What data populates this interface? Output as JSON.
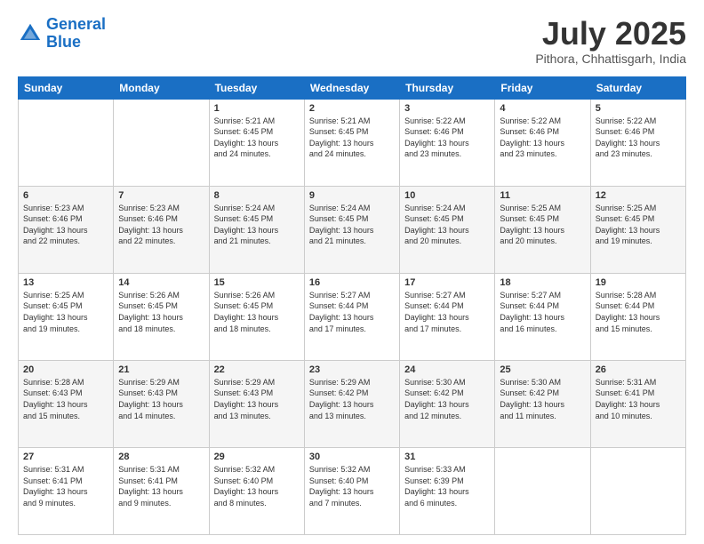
{
  "logo": {
    "line1": "General",
    "line2": "Blue"
  },
  "header": {
    "month": "July 2025",
    "location": "Pithora, Chhattisgarh, India"
  },
  "weekdays": [
    "Sunday",
    "Monday",
    "Tuesday",
    "Wednesday",
    "Thursday",
    "Friday",
    "Saturday"
  ],
  "weeks": [
    [
      {
        "day": "",
        "info": ""
      },
      {
        "day": "",
        "info": ""
      },
      {
        "day": "1",
        "info": "Sunrise: 5:21 AM\nSunset: 6:45 PM\nDaylight: 13 hours\nand 24 minutes."
      },
      {
        "day": "2",
        "info": "Sunrise: 5:21 AM\nSunset: 6:45 PM\nDaylight: 13 hours\nand 24 minutes."
      },
      {
        "day": "3",
        "info": "Sunrise: 5:22 AM\nSunset: 6:46 PM\nDaylight: 13 hours\nand 23 minutes."
      },
      {
        "day": "4",
        "info": "Sunrise: 5:22 AM\nSunset: 6:46 PM\nDaylight: 13 hours\nand 23 minutes."
      },
      {
        "day": "5",
        "info": "Sunrise: 5:22 AM\nSunset: 6:46 PM\nDaylight: 13 hours\nand 23 minutes."
      }
    ],
    [
      {
        "day": "6",
        "info": "Sunrise: 5:23 AM\nSunset: 6:46 PM\nDaylight: 13 hours\nand 22 minutes."
      },
      {
        "day": "7",
        "info": "Sunrise: 5:23 AM\nSunset: 6:46 PM\nDaylight: 13 hours\nand 22 minutes."
      },
      {
        "day": "8",
        "info": "Sunrise: 5:24 AM\nSunset: 6:45 PM\nDaylight: 13 hours\nand 21 minutes."
      },
      {
        "day": "9",
        "info": "Sunrise: 5:24 AM\nSunset: 6:45 PM\nDaylight: 13 hours\nand 21 minutes."
      },
      {
        "day": "10",
        "info": "Sunrise: 5:24 AM\nSunset: 6:45 PM\nDaylight: 13 hours\nand 20 minutes."
      },
      {
        "day": "11",
        "info": "Sunrise: 5:25 AM\nSunset: 6:45 PM\nDaylight: 13 hours\nand 20 minutes."
      },
      {
        "day": "12",
        "info": "Sunrise: 5:25 AM\nSunset: 6:45 PM\nDaylight: 13 hours\nand 19 minutes."
      }
    ],
    [
      {
        "day": "13",
        "info": "Sunrise: 5:25 AM\nSunset: 6:45 PM\nDaylight: 13 hours\nand 19 minutes."
      },
      {
        "day": "14",
        "info": "Sunrise: 5:26 AM\nSunset: 6:45 PM\nDaylight: 13 hours\nand 18 minutes."
      },
      {
        "day": "15",
        "info": "Sunrise: 5:26 AM\nSunset: 6:45 PM\nDaylight: 13 hours\nand 18 minutes."
      },
      {
        "day": "16",
        "info": "Sunrise: 5:27 AM\nSunset: 6:44 PM\nDaylight: 13 hours\nand 17 minutes."
      },
      {
        "day": "17",
        "info": "Sunrise: 5:27 AM\nSunset: 6:44 PM\nDaylight: 13 hours\nand 17 minutes."
      },
      {
        "day": "18",
        "info": "Sunrise: 5:27 AM\nSunset: 6:44 PM\nDaylight: 13 hours\nand 16 minutes."
      },
      {
        "day": "19",
        "info": "Sunrise: 5:28 AM\nSunset: 6:44 PM\nDaylight: 13 hours\nand 15 minutes."
      }
    ],
    [
      {
        "day": "20",
        "info": "Sunrise: 5:28 AM\nSunset: 6:43 PM\nDaylight: 13 hours\nand 15 minutes."
      },
      {
        "day": "21",
        "info": "Sunrise: 5:29 AM\nSunset: 6:43 PM\nDaylight: 13 hours\nand 14 minutes."
      },
      {
        "day": "22",
        "info": "Sunrise: 5:29 AM\nSunset: 6:43 PM\nDaylight: 13 hours\nand 13 minutes."
      },
      {
        "day": "23",
        "info": "Sunrise: 5:29 AM\nSunset: 6:42 PM\nDaylight: 13 hours\nand 13 minutes."
      },
      {
        "day": "24",
        "info": "Sunrise: 5:30 AM\nSunset: 6:42 PM\nDaylight: 13 hours\nand 12 minutes."
      },
      {
        "day": "25",
        "info": "Sunrise: 5:30 AM\nSunset: 6:42 PM\nDaylight: 13 hours\nand 11 minutes."
      },
      {
        "day": "26",
        "info": "Sunrise: 5:31 AM\nSunset: 6:41 PM\nDaylight: 13 hours\nand 10 minutes."
      }
    ],
    [
      {
        "day": "27",
        "info": "Sunrise: 5:31 AM\nSunset: 6:41 PM\nDaylight: 13 hours\nand 9 minutes."
      },
      {
        "day": "28",
        "info": "Sunrise: 5:31 AM\nSunset: 6:41 PM\nDaylight: 13 hours\nand 9 minutes."
      },
      {
        "day": "29",
        "info": "Sunrise: 5:32 AM\nSunset: 6:40 PM\nDaylight: 13 hours\nand 8 minutes."
      },
      {
        "day": "30",
        "info": "Sunrise: 5:32 AM\nSunset: 6:40 PM\nDaylight: 13 hours\nand 7 minutes."
      },
      {
        "day": "31",
        "info": "Sunrise: 5:33 AM\nSunset: 6:39 PM\nDaylight: 13 hours\nand 6 minutes."
      },
      {
        "day": "",
        "info": ""
      },
      {
        "day": "",
        "info": ""
      }
    ]
  ]
}
